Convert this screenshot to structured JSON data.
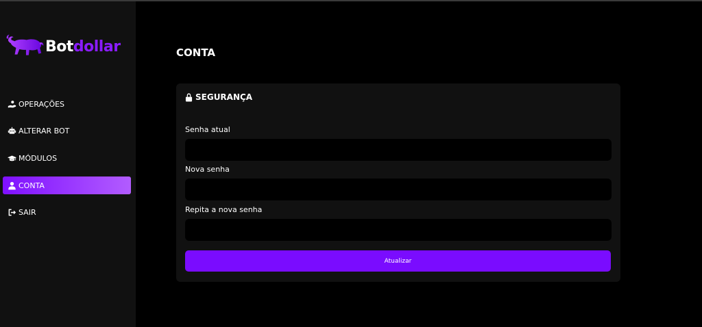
{
  "brand": {
    "part1": "Bot",
    "part2": "dollar",
    "accent": "#8a1cff"
  },
  "sidebar": {
    "items": [
      {
        "label": "OPERAÇÕES",
        "icon": "hand-coin-icon"
      },
      {
        "label": "ALTERAR BOT",
        "icon": "robot-icon"
      },
      {
        "label": "MÓDULOS",
        "icon": "graduation-cap-icon"
      },
      {
        "label": "CONTA",
        "icon": "user-icon",
        "active": true
      },
      {
        "label": "SAIR",
        "icon": "sign-out-icon"
      }
    ]
  },
  "page": {
    "title": "CONTA"
  },
  "security": {
    "title": "SEGURANÇA",
    "fields": [
      {
        "label": "Senha atual",
        "value": ""
      },
      {
        "label": "Nova senha",
        "value": ""
      },
      {
        "label": "Repita a nova senha",
        "value": ""
      }
    ],
    "submit_label": "Atualizar"
  },
  "colors": {
    "sidebar_bg": "#111111",
    "card_bg": "#111111",
    "button": "#7a0cff"
  }
}
